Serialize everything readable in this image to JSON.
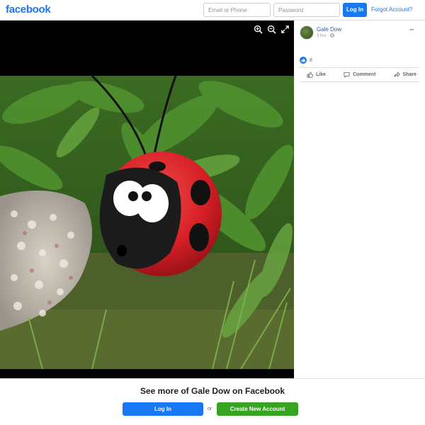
{
  "header": {
    "logo": "facebook",
    "email_placeholder": "Email or Phone",
    "password_placeholder": "Password",
    "login_label": "Log In",
    "forgot_label": "Forgot Account?"
  },
  "viewer": {
    "tools": [
      "zoom-in-icon",
      "zoom-out-icon",
      "fullscreen-icon"
    ]
  },
  "post": {
    "author": "Gale Dow",
    "time": "3 hrs · ",
    "privacy_icon": "globe-icon",
    "more_label": "···",
    "reaction_count": "8",
    "actions": {
      "like": "Like",
      "comment": "Comment",
      "share": "Share"
    }
  },
  "banner": {
    "title": "See more of Gale Dow on Facebook",
    "login_label": "Log In",
    "or_label": "or",
    "create_label": "Create New Account"
  },
  "colors": {
    "brand": "#1877f2",
    "create_green": "#36a420"
  }
}
